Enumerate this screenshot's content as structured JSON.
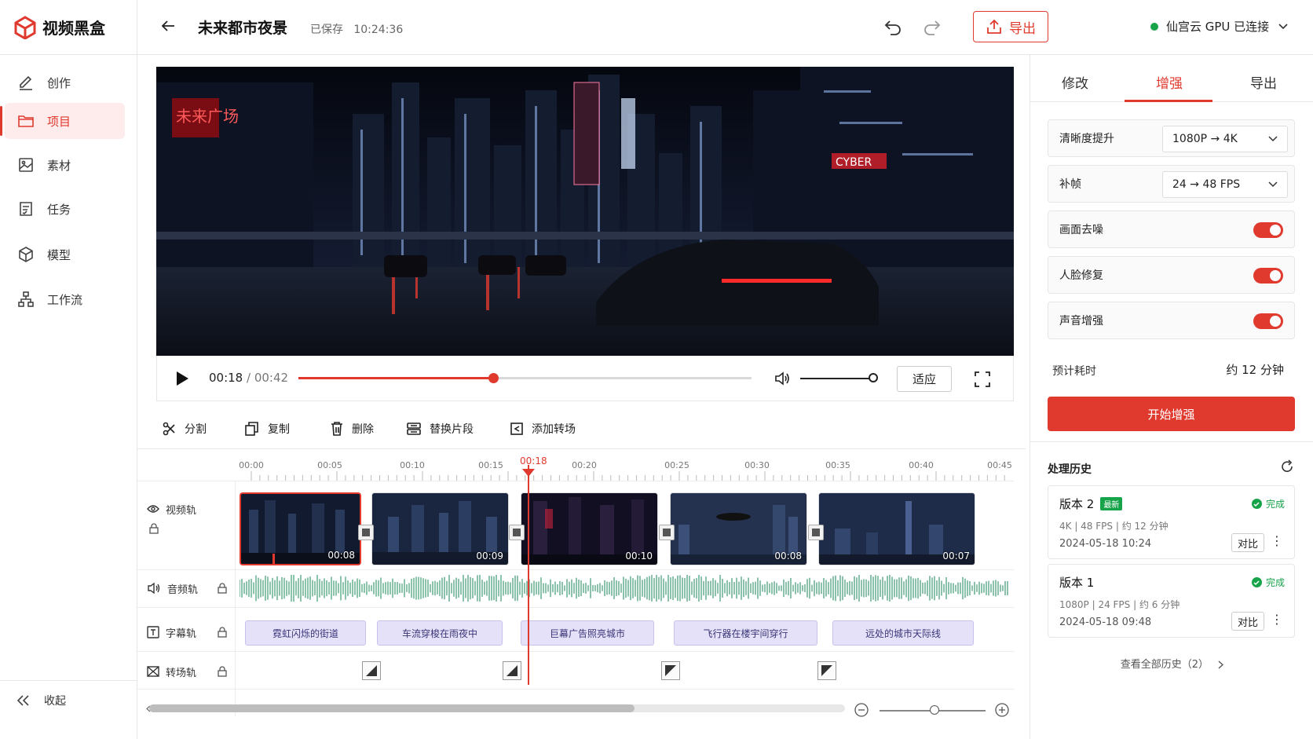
{
  "app": {
    "name": "视频黑盒"
  },
  "sidebar": {
    "items": [
      {
        "label": "创作",
        "icon": "pencil-icon"
      },
      {
        "label": "项目",
        "icon": "folder-icon",
        "active": true
      },
      {
        "label": "素材",
        "icon": "image-icon"
      },
      {
        "label": "任务",
        "icon": "task-list-icon"
      },
      {
        "label": "模型",
        "icon": "cube-icon"
      },
      {
        "label": "工作流",
        "icon": "workflow-icon"
      }
    ],
    "collapse_label": "收起"
  },
  "header": {
    "title": "未来都市夜景",
    "saved_status": "已保存",
    "saved_time": "10:24:36",
    "export_label": "导出",
    "connection": "仙宫云 GPU 已连接",
    "connection_color": "#17a34a"
  },
  "player": {
    "current_time": "00:18",
    "total_time": "/ 00:42",
    "progress": 0.43,
    "volume": 1.0,
    "fit_label": "适应"
  },
  "toolbar": {
    "split": "分割",
    "copy": "复制",
    "delete": "删除",
    "replace": "替换片段",
    "add_transition": "添加转场"
  },
  "timeline": {
    "ruler": [
      "00:00",
      "00:05",
      "00:10",
      "00:15",
      "00:20",
      "00:25",
      "00:30",
      "00:35",
      "00:40",
      "00:45"
    ],
    "playhead_label": "00:18",
    "tracks": {
      "video": "视频轨",
      "audio": "音频轨",
      "subtitle": "字幕轨",
      "transition": "转场轨"
    },
    "clips": [
      {
        "duration": "00:08",
        "selected": true
      },
      {
        "duration": "00:09"
      },
      {
        "duration": "00:10"
      },
      {
        "duration": "00:08"
      },
      {
        "duration": "00:07"
      }
    ],
    "subtitles": [
      "霓虹闪烁的街道",
      "车流穿梭在雨夜中",
      "巨幕广告照亮城市",
      "飞行器在楼宇间穿行",
      "远处的城市天际线"
    ]
  },
  "panel": {
    "tabs": [
      "修改",
      "增强",
      "导出"
    ],
    "active_tab": "增强",
    "resolution_label": "清晰度提升",
    "resolution_value": "1080P → 4K",
    "frame_label": "补帧",
    "frame_value": "24 → 48 FPS",
    "toggles": [
      {
        "label": "画面去噪",
        "on": true
      },
      {
        "label": "人脸修复",
        "on": true
      },
      {
        "label": "声音增强",
        "on": true
      }
    ],
    "estimate_label": "预计耗时",
    "estimate_value": "约 12 分钟",
    "start_label": "开始增强",
    "accent": "#e03a2f"
  },
  "history": {
    "title": "处理历史",
    "versions": [
      {
        "name": "版本 2",
        "badge": "最新",
        "status": "完成",
        "spec": "4K | 48 FPS | 约 12 分钟",
        "date": "2024-05-18 10:24",
        "compare": "对比"
      },
      {
        "name": "版本 1",
        "status": "完成",
        "spec": "1080P | 24 FPS | 约 6 分钟",
        "date": "2024-05-18 09:48",
        "compare": "对比"
      }
    ],
    "view_all": "查看全部历史（2）"
  }
}
